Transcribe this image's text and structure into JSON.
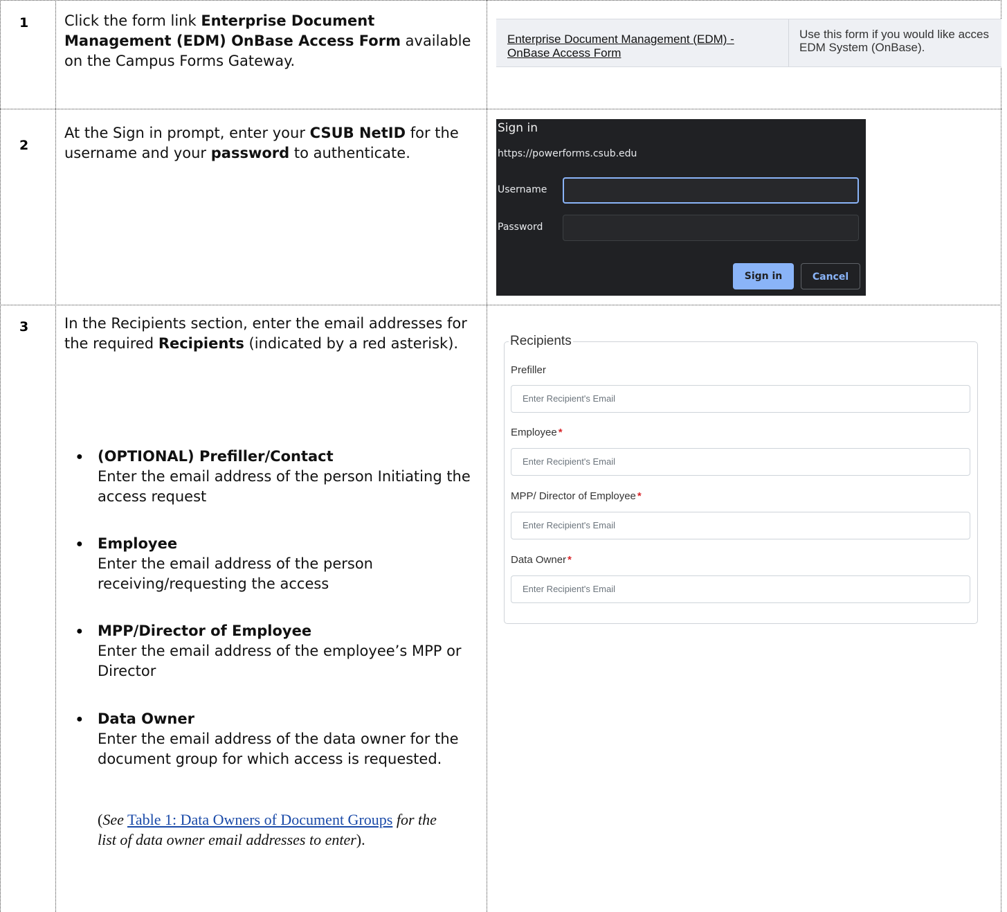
{
  "steps": [
    {
      "number": "1",
      "text_prefix": "Click the form link ",
      "text_bold": "Enterprise Document Management (EDM) OnBase Access Form",
      "text_suffix": " available on the Campus Forms Gateway.",
      "screenshot": {
        "link_text": "Enterprise Document Management (EDM) - OnBase Access Form",
        "description_line1": "Use this form if you would like acces",
        "description_line2": "EDM System (OnBase)."
      }
    },
    {
      "number": "2",
      "text_part1": "At the Sign in prompt, enter your ",
      "text_bold1": "CSUB NetID",
      "text_part2": " for the username and your ",
      "text_bold2": "password",
      "text_part3": " to authenticate.",
      "dialog": {
        "title": "Sign in",
        "url": "https://powerforms.csub.edu",
        "username_label": "Username",
        "password_label": "Password",
        "signin_button": "Sign in",
        "cancel_button": "Cancel"
      }
    },
    {
      "number": "3",
      "intro_part1": "In the Recipients section, enter the email addresses for the required ",
      "intro_bold": "Recipients",
      "intro_part2": " (indicated by a red asterisk).",
      "bullets": [
        {
          "title": "(OPTIONAL) Prefiller/Contact",
          "desc": "Enter the email address of the person Initiating the access request"
        },
        {
          "title": "Employee",
          "desc": "Enter the email address of the person receiving/requesting the access"
        },
        {
          "title": "MPP/Director of Employee",
          "desc": "Enter the email address of the employee’s MPP or Director"
        },
        {
          "title": "Data Owner",
          "desc": "Enter the email address of the data owner for the document group for which access is requested."
        }
      ],
      "note_open": "(",
      "note_see": "See",
      "note_link": "Table 1: Data Owners of Document Groups",
      "note_rest": " for the list of data owner email addresses to enter",
      "note_close": ").",
      "recipients": {
        "legend": "Recipients",
        "fields": [
          {
            "label": "Prefiller",
            "required": false,
            "placeholder": "Enter Recipient's Email"
          },
          {
            "label": "Employee",
            "required": true,
            "placeholder": "Enter Recipient's Email"
          },
          {
            "label": "MPP/ Director of Employee",
            "required": true,
            "placeholder": "Enter Recipient's Email"
          },
          {
            "label": "Data Owner",
            "required": true,
            "placeholder": "Enter Recipient's Email"
          }
        ],
        "required_marker": "*",
        "required_color": "#d9262b"
      }
    }
  ],
  "icons": {
    "bullet": "bullet-dot-icon"
  },
  "bullet_char": "●"
}
